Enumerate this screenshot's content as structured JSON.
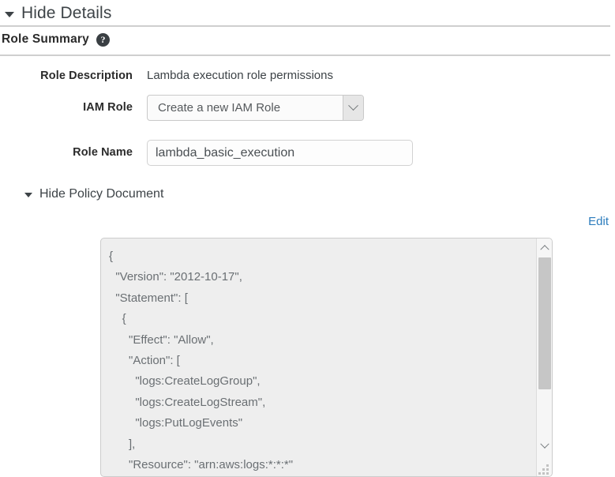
{
  "details_section": {
    "toggle_label": "Hide Details",
    "caret_icon": "caret-down-icon"
  },
  "role_summary": {
    "title": "Role Summary",
    "help_icon": "question-mark-circle-icon"
  },
  "fields": {
    "role_description": {
      "label": "Role Description",
      "value": "Lambda execution role permissions"
    },
    "iam_role": {
      "label": "IAM Role",
      "selected": "Create a new IAM Role",
      "dropdown_icon": "chevron-down-icon"
    },
    "role_name": {
      "label": "Role Name",
      "value": "lambda_basic_execution",
      "placeholder": "Role Name"
    }
  },
  "policy_document": {
    "toggle_label": "Hide Policy Document",
    "caret_icon": "caret-down-icon",
    "edit_label": "Edit",
    "content": "{\n  \"Version\": \"2012-10-17\",\n  \"Statement\": [\n    {\n      \"Effect\": \"Allow\",\n      \"Action\": [\n        \"logs:CreateLogGroup\",\n        \"logs:CreateLogStream\",\n        \"logs:PutLogEvents\"\n      ],\n      \"Resource\": \"arn:aws:logs:*:*:*\"",
    "scrollbar": {
      "up_icon": "chevron-up-icon",
      "down_icon": "chevron-down-icon",
      "thumb": "scrollbar-thumb"
    },
    "resize_icon": "resize-grip-icon"
  },
  "colors": {
    "link": "#2d7dbd",
    "text": "#3d4347",
    "label": "#2b2b2b",
    "divider": "#cfcfcf",
    "textarea_bg": "#eeeeee",
    "scrollbar_thumb": "#c6c6c6"
  }
}
